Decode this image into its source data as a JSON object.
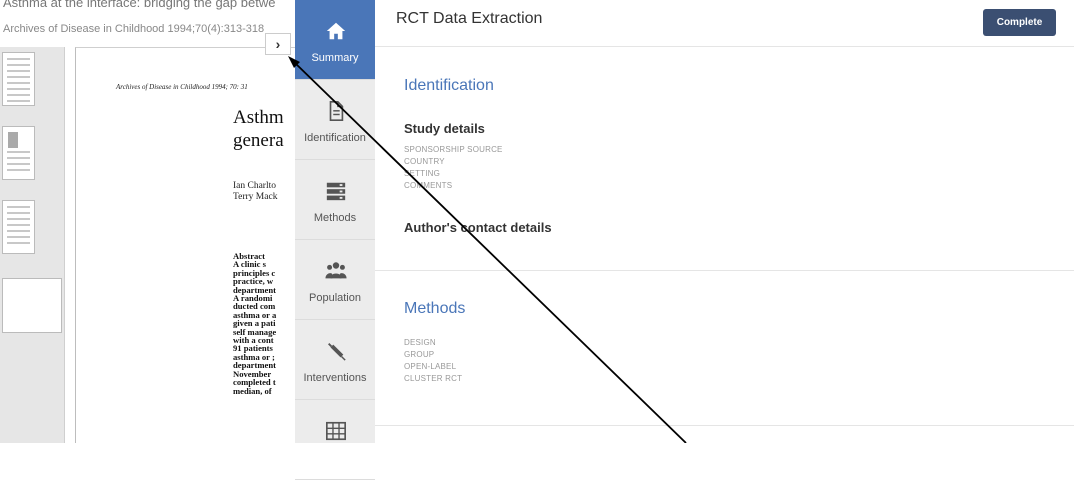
{
  "document": {
    "title": "Asthma at the interface: bridging the gap betwe",
    "citation": "Archives of Disease in Childhood 1994;70(4):313-318",
    "toggle_icon": "chevron-right-icon",
    "page": {
      "journal": "Archives of Disease in Childhood 1994; 70: 31",
      "title_lines": [
        "Asthm",
        "genera"
      ],
      "authors_lines": [
        "Ian Charlto",
        "Terry Mack"
      ],
      "abstract_lines": [
        "Abstract",
        "A  clinic  s",
        "principles  c",
        "practice,  w",
        "department",
        "A  randomi",
        "ducted  com",
        "asthma  or  a",
        "given  a  pati",
        "self manage",
        "with a cont",
        "91  patients",
        "asthma  or  ;",
        "department",
        "November",
        "completed  t",
        "median,  of"
      ]
    }
  },
  "nav": {
    "items": [
      {
        "label": "Summary",
        "icon": "home-icon",
        "active": true
      },
      {
        "label": "Identification",
        "icon": "document-icon",
        "active": false
      },
      {
        "label": "Methods",
        "icon": "list-icon",
        "active": false
      },
      {
        "label": "Population",
        "icon": "people-icon",
        "active": false
      },
      {
        "label": "Interventions",
        "icon": "syringe-icon",
        "active": false
      },
      {
        "label": "",
        "icon": "table-icon",
        "active": false
      }
    ]
  },
  "main": {
    "title": "RCT Data Extraction",
    "complete_label": "Complete",
    "identification": {
      "title": "Identification",
      "study_details": {
        "heading": "Study details",
        "fields": [
          "SPONSORSHIP SOURCE",
          "COUNTRY",
          "SETTING",
          "COMMENTS"
        ]
      },
      "contact_heading": "Author's contact details"
    },
    "methods": {
      "title": "Methods",
      "fields": [
        "DESIGN",
        "GROUP",
        "OPEN-LABEL",
        "CLUSTER RCT"
      ]
    }
  },
  "colors": {
    "accent": "#4a76b8",
    "button": "#3b4f72",
    "nav_bg": "#ececec"
  }
}
